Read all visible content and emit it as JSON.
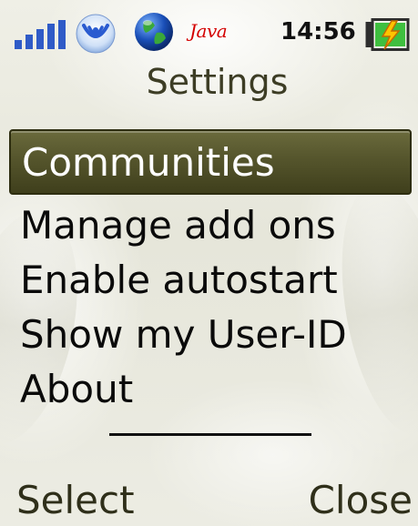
{
  "status_bar": {
    "signal_icon": "signal-strength-icon",
    "wifi_icon": "wireless-icon",
    "globe_icon": "globe-icon",
    "java_label": "Java",
    "time": "14:56",
    "battery_icon": "battery-charging-icon"
  },
  "header": {
    "title": "Settings"
  },
  "menu": {
    "items": [
      {
        "label": "Communities",
        "selected": true
      },
      {
        "label": "Manage add ons",
        "selected": false
      },
      {
        "label": "Enable autostart",
        "selected": false
      },
      {
        "label": "Show my User-ID",
        "selected": false
      },
      {
        "label": "About",
        "selected": false
      }
    ]
  },
  "softkeys": {
    "left": "Select",
    "right": "Close"
  },
  "colors": {
    "selection_bg": "#55552c",
    "title_text": "#3d3d25",
    "clock_text": "#111111",
    "java_text": "#d40000",
    "signal": "#2f5bc7"
  }
}
